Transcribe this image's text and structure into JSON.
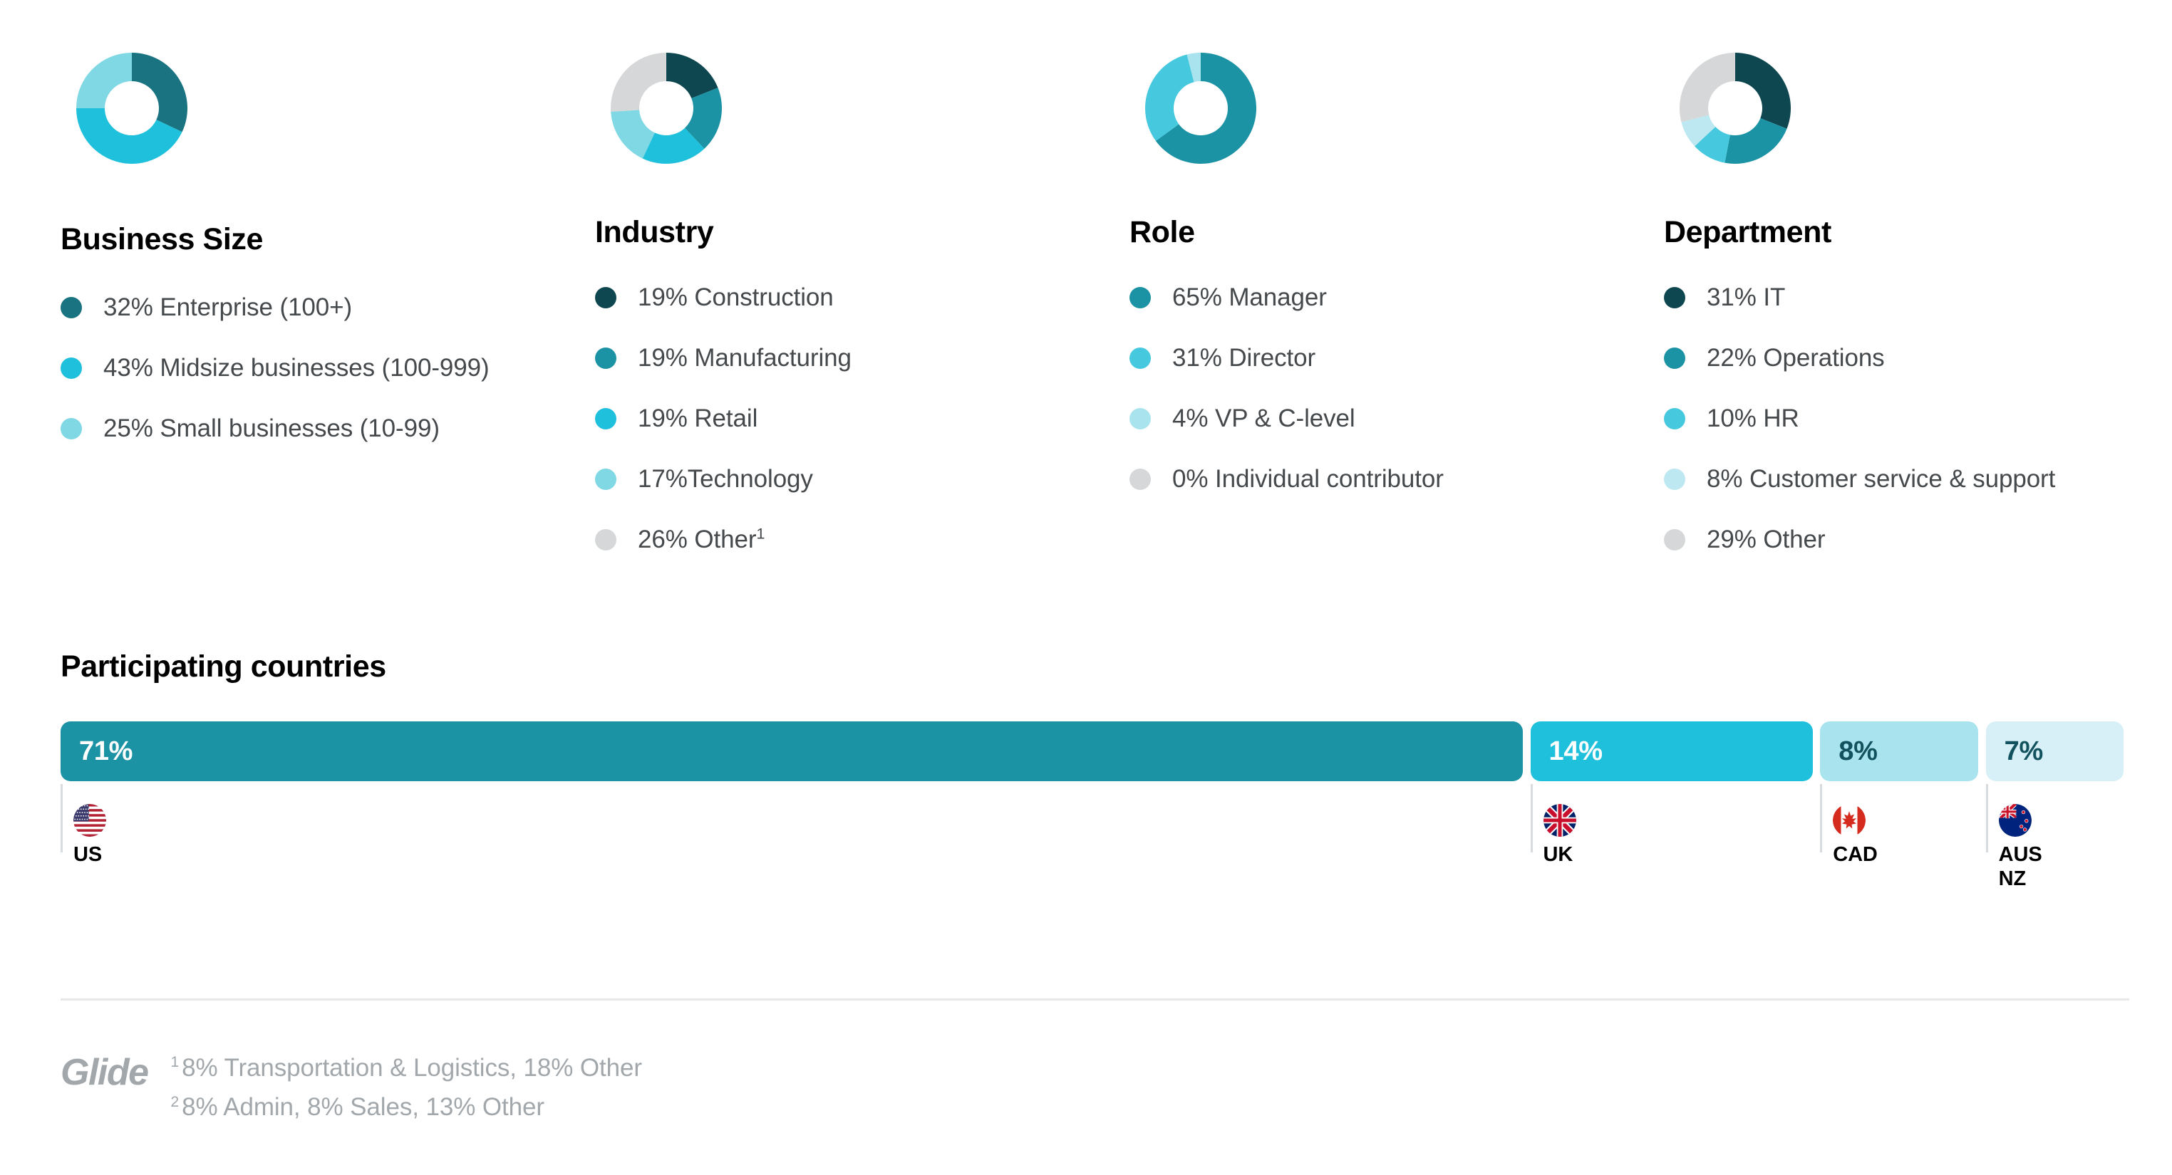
{
  "palette": {
    "darkest_teal": "#0F4751",
    "dark_teal": "#1A7380",
    "mid_teal": "#1B93A4",
    "cyan": "#1FC0DC",
    "light_cyan": "#7FD8E4",
    "pale_cyan": "#BEE8F1",
    "paler_cyan": "#D7F0F7",
    "gray": "#D5D7D8",
    "text": "#45494c",
    "muted": "#a2a7ab"
  },
  "columns": [
    {
      "title": "Business Size",
      "legend": [
        {
          "percent": "32%",
          "label": "Enterprise (100+)",
          "color": "#1A7380",
          "value": 32
        },
        {
          "percent": "43%",
          "label": "Midsize businesses (100-999)",
          "color": "#1FC0DC",
          "value": 43
        },
        {
          "percent": "25%",
          "label": "Small businesses (10-99)",
          "color": "#7FD8E4",
          "value": 25
        }
      ]
    },
    {
      "title": "Industry",
      "legend": [
        {
          "percent": "19%",
          "label": "Construction",
          "color": "#0F4751",
          "value": 19
        },
        {
          "percent": "19%",
          "label": "Manufacturing",
          "color": "#1B93A4",
          "value": 19
        },
        {
          "percent": "19%",
          "label": "Retail",
          "color": "#1FC0DC",
          "value": 19
        },
        {
          "percent": "17%",
          "label": "Technology",
          "color": "#7FD8E4",
          "value": 17,
          "no_space": true
        },
        {
          "percent": "26%",
          "label": "Other",
          "color": "#D5D7D8",
          "value": 26,
          "footnote": "1"
        }
      ]
    },
    {
      "title": "Role",
      "legend": [
        {
          "percent": "65%",
          "label": "Manager",
          "color": "#1B93A4",
          "value": 65
        },
        {
          "percent": "31%",
          "label": "Director",
          "color": "#46C9DE",
          "value": 31
        },
        {
          "percent": "4%",
          "label": "VP & C-level",
          "color": "#A9E4EE",
          "value": 4
        },
        {
          "percent": "0%",
          "label": "Individual contributor",
          "color": "#D5D7D8",
          "value": 0
        }
      ]
    },
    {
      "title": "Department",
      "legend": [
        {
          "percent": "31%",
          "label": "IT",
          "color": "#0F4751",
          "value": 31
        },
        {
          "percent": "22%",
          "label": "Operations",
          "color": "#1B93A4",
          "value": 22
        },
        {
          "percent": "10%",
          "label": "HR",
          "color": "#46C9DE",
          "value": 10
        },
        {
          "percent": "8%",
          "label": "Customer service & support",
          "color": "#BEE8F1",
          "value": 8
        },
        {
          "percent": "29%",
          "label": "Other",
          "color": "#D5D7D8",
          "value": 29
        }
      ]
    }
  ],
  "countries": {
    "title": "Participating countries",
    "segments": [
      {
        "code": "US",
        "label": "71%",
        "value": 71,
        "color": "#1B93A4",
        "label_color": "#ffffff",
        "flag": "flag-us-icon"
      },
      {
        "code": "UK",
        "label": "14%",
        "value": 14,
        "color": "#1FC0DC",
        "label_color": "#ffffff",
        "flag": "flag-uk-icon"
      },
      {
        "code": "CAD",
        "label": "8%",
        "value": 8,
        "color": "#A9E4EE",
        "label_color": "#11525E",
        "flag": "flag-ca-icon"
      },
      {
        "code": "AUS\nNZ",
        "label": "7%",
        "value": 7,
        "color": "#D7F0F7",
        "label_color": "#11525E",
        "flag": "flag-nz-icon"
      }
    ]
  },
  "footer": {
    "logo": "Glide",
    "footnotes": [
      {
        "marker": "1",
        "text": "8% Transportation & Logistics, 18% Other"
      },
      {
        "marker": "2",
        "text": "8% Admin, 8% Sales, 13% Other"
      }
    ]
  },
  "chart_data": [
    {
      "type": "pie",
      "title": "Business Size",
      "categories": [
        "Enterprise (100+)",
        "Midsize businesses (100-999)",
        "Small businesses (10-99)"
      ],
      "values": [
        32,
        43,
        25
      ],
      "colors": [
        "#1A7380",
        "#1FC0DC",
        "#7FD8E4"
      ],
      "unit": "%",
      "legend": "below"
    },
    {
      "type": "pie",
      "title": "Industry",
      "categories": [
        "Construction",
        "Manufacturing",
        "Retail",
        "Technology",
        "Other"
      ],
      "values": [
        19,
        19,
        19,
        17,
        26
      ],
      "colors": [
        "#0F4751",
        "#1B93A4",
        "#1FC0DC",
        "#7FD8E4",
        "#D5D7D8"
      ],
      "unit": "%",
      "legend": "below",
      "notes": "Other = 8% Transportation & Logistics, 18% Other"
    },
    {
      "type": "pie",
      "title": "Role",
      "categories": [
        "Manager",
        "Director",
        "VP & C-level",
        "Individual contributor"
      ],
      "values": [
        65,
        31,
        4,
        0
      ],
      "colors": [
        "#1B93A4",
        "#46C9DE",
        "#A9E4EE",
        "#D5D7D8"
      ],
      "unit": "%",
      "legend": "below"
    },
    {
      "type": "pie",
      "title": "Department",
      "categories": [
        "IT",
        "Operations",
        "HR",
        "Customer service & support",
        "Other"
      ],
      "values": [
        31,
        22,
        10,
        8,
        29
      ],
      "colors": [
        "#0F4751",
        "#1B93A4",
        "#46C9DE",
        "#BEE8F1",
        "#D5D7D8"
      ],
      "unit": "%",
      "legend": "below",
      "notes": "Other = 8% Admin, 8% Sales, 13% Other"
    },
    {
      "type": "bar",
      "title": "Participating countries",
      "orientation": "horizontal-stacked",
      "categories": [
        "US",
        "UK",
        "CAD",
        "AUS NZ"
      ],
      "values": [
        71,
        14,
        8,
        7
      ],
      "colors": [
        "#1B93A4",
        "#1FC0DC",
        "#A9E4EE",
        "#D7F0F7"
      ],
      "unit": "%",
      "xlim": [
        0,
        100
      ]
    }
  ]
}
